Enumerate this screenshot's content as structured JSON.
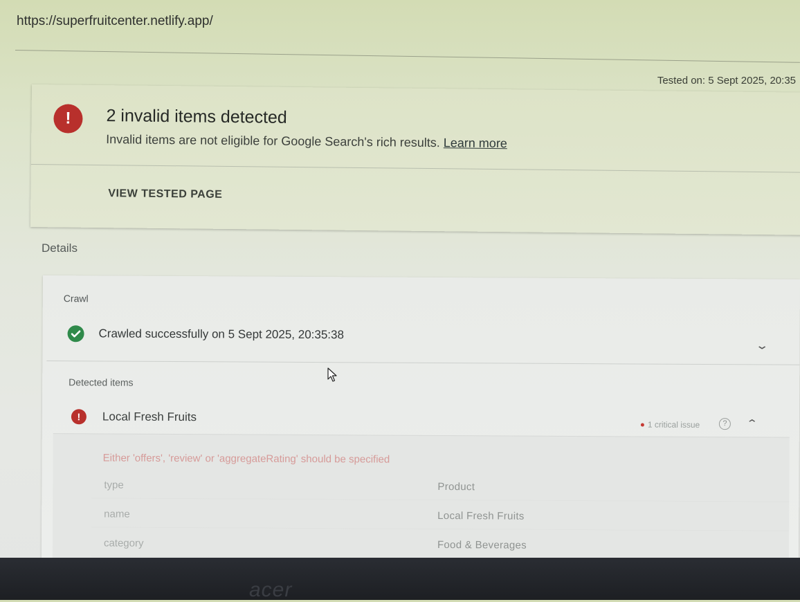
{
  "url": "https://superfruitcenter.netlify.app/",
  "tested_on": "Tested on: 5 Sept 2025, 20:35",
  "summary": {
    "icon": "!",
    "title": "2 invalid items detected",
    "subtitle": "Invalid items are not eligible for Google Search's rich results.",
    "learn_more": "Learn more",
    "view_tested_page": "VIEW TESTED PAGE"
  },
  "details_label": "Details",
  "crawl": {
    "label": "Crawl",
    "status": "Crawled successfully on 5 Sept 2025, 20:35:38"
  },
  "detected": {
    "label": "Detected items",
    "item": {
      "icon": "!",
      "name": "Local Fresh Fruits",
      "issue_badge": "1 critical issue",
      "help": "?",
      "issue_text": "Either 'offers', 'review' or 'aggregateRating' should be specified",
      "properties": [
        {
          "key": "type",
          "value": "Product"
        },
        {
          "key": "name",
          "value": "Local Fresh Fruits"
        },
        {
          "key": "category",
          "value": "Food & Beverages"
        }
      ]
    }
  },
  "bezel_logo": "acer",
  "colors": {
    "error": "#b8302c",
    "success": "#2f8a4a"
  },
  "icons": {
    "error": "error-icon",
    "success": "check-circle-icon",
    "expand": "chevron-down-icon",
    "collapse": "chevron-up-icon",
    "help": "help-icon"
  }
}
